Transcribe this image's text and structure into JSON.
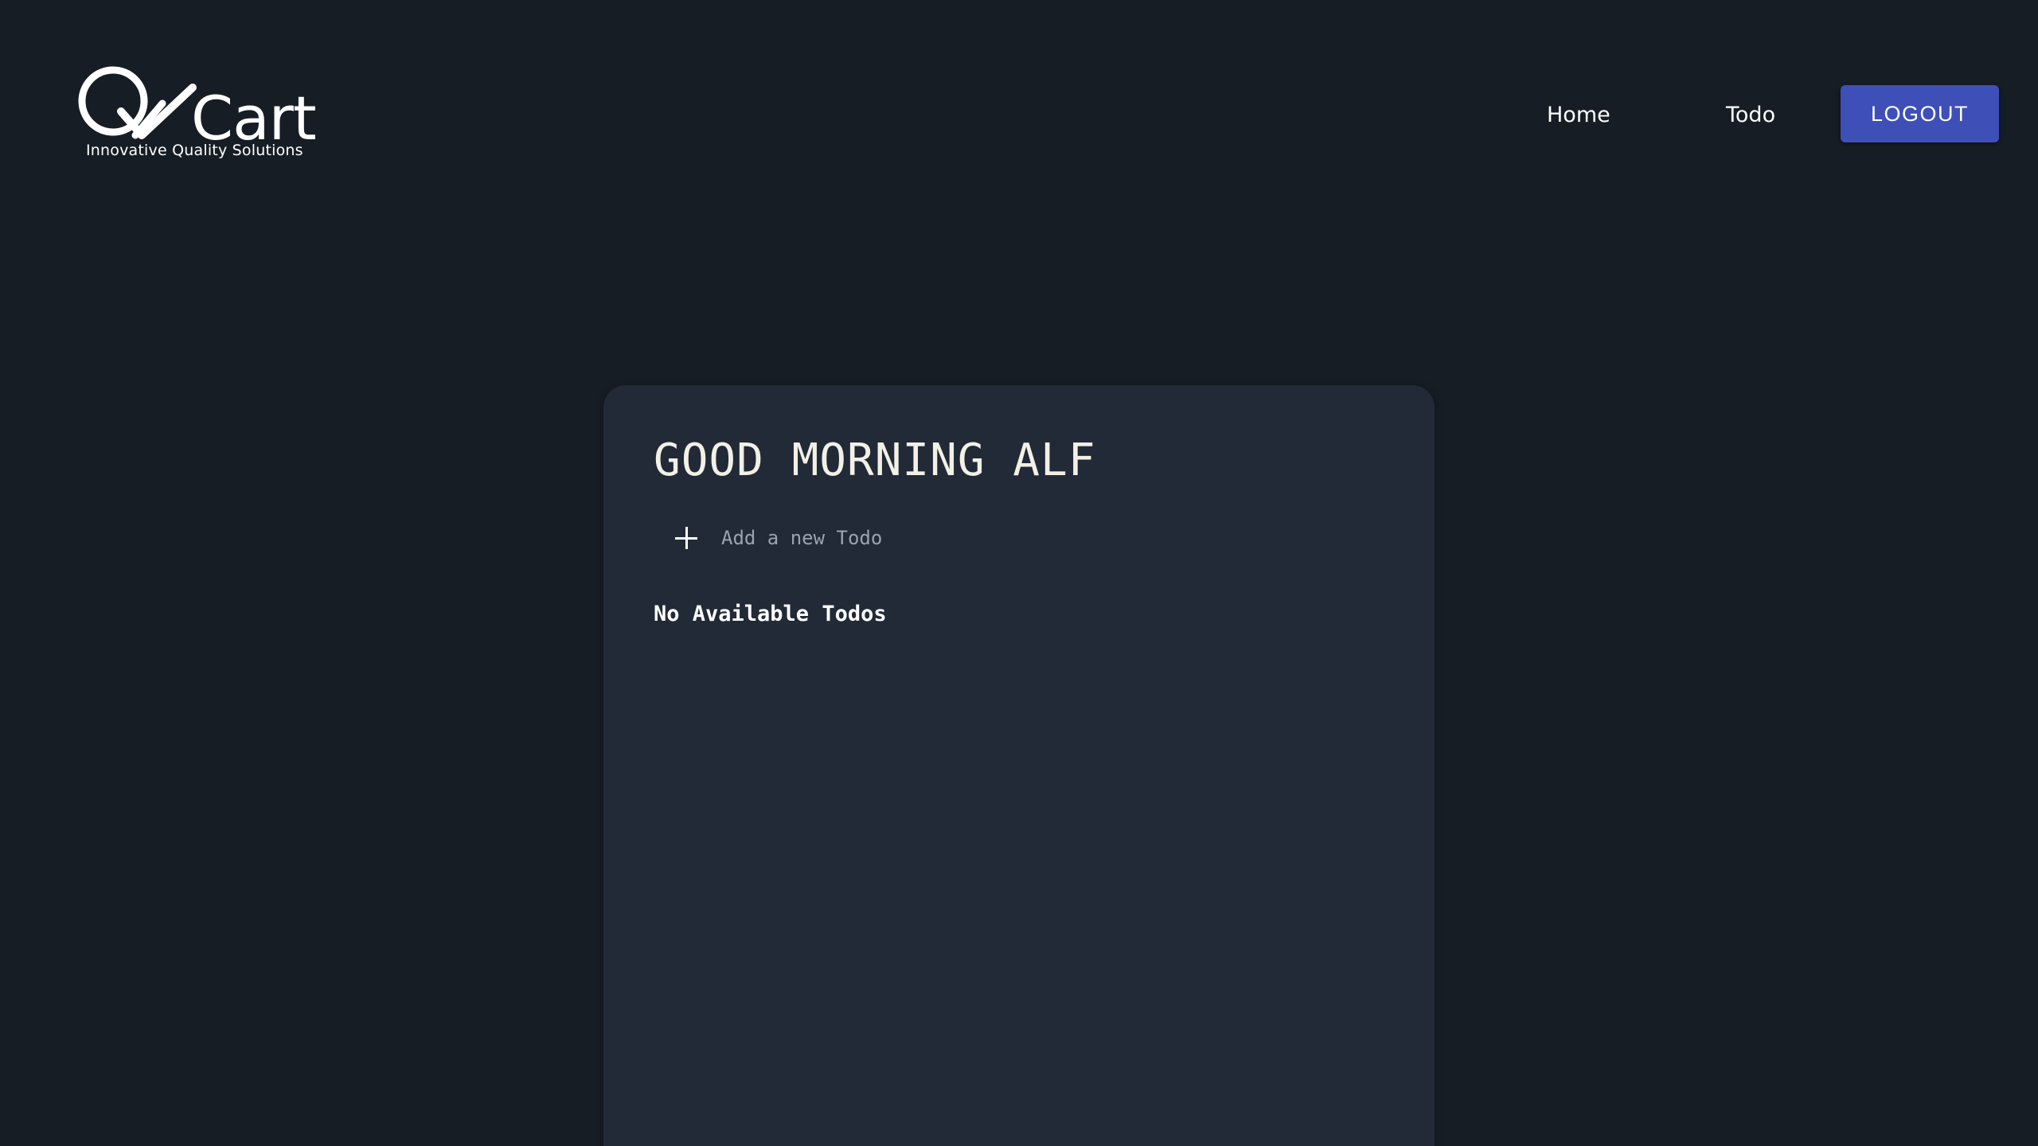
{
  "header": {
    "logo": {
      "wordmark": "QACart",
      "tagline": "Innovative Quality Solutions"
    },
    "nav": {
      "home_label": "Home",
      "todo_label": "Todo"
    },
    "logout_label": "LOGOUT"
  },
  "colors": {
    "background": "#171d25",
    "card": "#212a36",
    "accent": "#3e4fb8"
  },
  "card": {
    "greeting": "GOOD MORNING ALF",
    "add_todo": {
      "icon": "plus-icon",
      "placeholder": "Add a new Todo",
      "value": ""
    },
    "empty_message": "No Available Todos"
  }
}
